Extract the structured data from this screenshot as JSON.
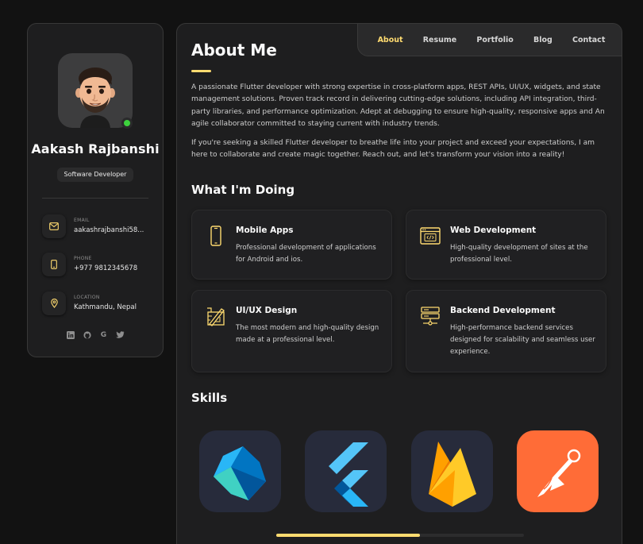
{
  "profile": {
    "name": "Aakash Rajbanshi",
    "title": "Software Developer",
    "contacts": [
      {
        "label": "EMAIL",
        "value": "aakashrajbanshi58...",
        "icon": "mail-icon"
      },
      {
        "label": "PHONE",
        "value": "+977 9812345678",
        "icon": "phone-icon"
      },
      {
        "label": "LOCATION",
        "value": "Kathmandu, Nepal",
        "icon": "location-icon"
      }
    ],
    "socials": [
      "linkedin-icon",
      "github-icon",
      "google-icon",
      "twitter-icon"
    ]
  },
  "nav": {
    "items": [
      "About",
      "Resume",
      "Portfolio",
      "Blog",
      "Contact"
    ],
    "active": "About"
  },
  "about": {
    "heading": "About Me",
    "paragraph1": "A passionate Flutter developer with strong expertise in cross-platform apps, REST APIs, UI/UX, widgets, and state management solutions. Proven track record in delivering cutting-edge solutions, including API integration, third-party libraries, and performance optimization. Adept at debugging to ensure high-quality, responsive apps and An agile collaborator committed to staying current with industry trends.",
    "paragraph2": "If you're seeking a skilled Flutter developer to breathe life into your project and exceed your expectations, I am here to collaborate and create magic together. Reach out, and let's transform your vision into a reality!"
  },
  "services": {
    "heading": "What I'm Doing",
    "items": [
      {
        "title": "Mobile Apps",
        "text": "Professional development of applications for Android and ios.",
        "icon": "mobile-icon"
      },
      {
        "title": "Web Development",
        "text": "High-quality development of sites at the professional level.",
        "icon": "web-code-icon"
      },
      {
        "title": "UI/UX Design",
        "text": "The most modern and high-quality design made at a professional level.",
        "icon": "design-icon"
      },
      {
        "title": "Backend Development",
        "text": "High-performance backend services designed for scalability and seamless user experience.",
        "icon": "server-icon"
      }
    ]
  },
  "skills": {
    "heading": "Skills",
    "items": [
      {
        "name": "dart-logo",
        "bg": "#272b3b"
      },
      {
        "name": "flutter-logo",
        "bg": "#272b3b"
      },
      {
        "name": "firebase-logo",
        "bg": "#272b3b"
      },
      {
        "name": "postman-logo",
        "bg": "#ff6c37"
      }
    ],
    "scroll_progress": 0.58
  },
  "colors": {
    "accent": "#ffdb70",
    "background": "#121212",
    "card": "#1e1e1f",
    "online": "#3dd23d"
  }
}
